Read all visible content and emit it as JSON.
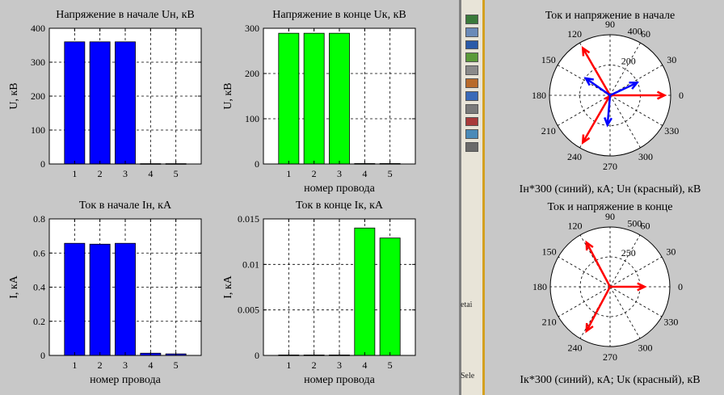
{
  "colors": {
    "background": "#c8c8c8",
    "blue": "#0000ff",
    "green": "#00ff00",
    "red": "#ff0000",
    "axes": "#ffffff"
  },
  "strip": {
    "labels": [
      "etai",
      "Sele"
    ]
  },
  "chart_data": [
    {
      "id": "un",
      "type": "bar",
      "title": "Напряжение в начале Uн, кВ",
      "xlabel": "",
      "ylabel": "U, кВ",
      "categories": [
        "1",
        "2",
        "3",
        "4",
        "5"
      ],
      "values": [
        360,
        360,
        360,
        1,
        1
      ],
      "ylim": [
        0,
        400
      ],
      "yticks": [
        "0",
        "100",
        "200",
        "300",
        "400"
      ],
      "grid": true,
      "color": "#0000ff"
    },
    {
      "id": "uk",
      "type": "bar",
      "title": "Напряжение в конце Uк, кВ",
      "xlabel": "номер провода",
      "ylabel": "U, кВ",
      "categories": [
        "1",
        "2",
        "3",
        "4",
        "5"
      ],
      "values": [
        289,
        289,
        289,
        1,
        1
      ],
      "ylim": [
        0,
        300
      ],
      "yticks": [
        "0",
        "100",
        "200",
        "300"
      ],
      "grid": true,
      "color": "#00ff00"
    },
    {
      "id": "in",
      "type": "bar",
      "title": "Ток в начале Iн, кА",
      "xlabel": "номер провода",
      "ylabel": "I, кА",
      "categories": [
        "1",
        "2",
        "3",
        "4",
        "5"
      ],
      "values": [
        0.657,
        0.652,
        0.657,
        0.013,
        0.009
      ],
      "ylim": [
        0,
        0.8
      ],
      "yticks": [
        "0",
        "0.2",
        "0.4",
        "0.6",
        "0.8"
      ],
      "grid": true,
      "color": "#0000ff"
    },
    {
      "id": "ik",
      "type": "bar",
      "title": "Ток в конце Iк, кА",
      "xlabel": "номер провода",
      "ylabel": "I, кА",
      "categories": [
        "1",
        "2",
        "3",
        "4",
        "5"
      ],
      "values": [
        5e-05,
        5e-05,
        5e-05,
        0.014,
        0.0129
      ],
      "ylim": [
        0,
        0.015
      ],
      "yticks": [
        "0",
        "0.005",
        "0.01",
        "0.015"
      ],
      "grid": true,
      "color": "#00ff00"
    },
    {
      "id": "polar_start",
      "type": "polar",
      "title": "Ток и напряжение в начале",
      "xlabel": "Iн*300 (синий), кА; Uн (красный), кВ",
      "rmax": 400,
      "rticks": [
        "200",
        "400"
      ],
      "angle_ticks": [
        "0",
        "30",
        "60",
        "90",
        "120",
        "150",
        "180",
        "210",
        "240",
        "270",
        "300",
        "330"
      ],
      "series": [
        {
          "color": "#ff0000",
          "vectors": [
            {
              "r": 360,
              "angle": 0
            },
            {
              "r": 360,
              "angle": 120
            },
            {
              "r": 360,
              "angle": 240
            },
            {
              "r": 12,
              "angle": 0
            },
            {
              "r": 12,
              "angle": 0
            }
          ]
        },
        {
          "color": "#0000ff",
          "vectors": [
            {
              "r": 197,
              "angle": 25
            },
            {
              "r": 196,
              "angle": 145
            },
            {
              "r": 197,
              "angle": 265
            },
            {
              "r": 4,
              "angle": 0
            },
            {
              "r": 3,
              "angle": 0
            }
          ]
        }
      ]
    },
    {
      "id": "polar_end",
      "type": "polar",
      "title": "Ток и напряжение в конце",
      "xlabel": "Iк*300 (синий), кА; Uк (красный), кВ",
      "rmax": 500,
      "rticks": [
        "250",
        "500"
      ],
      "angle_ticks": [
        "0",
        "30",
        "60",
        "90",
        "120",
        "150",
        "180",
        "210",
        "240",
        "270",
        "300",
        "330"
      ],
      "series": [
        {
          "color": "#ff0000",
          "vectors": [
            {
              "r": 289,
              "angle": 0
            },
            {
              "r": 420,
              "angle": 118
            },
            {
              "r": 420,
              "angle": 242
            },
            {
              "r": 10,
              "angle": 0
            },
            {
              "r": 10,
              "angle": 0
            }
          ]
        },
        {
          "color": "#0000ff",
          "vectors": [
            {
              "r": 4,
              "angle": 0
            },
            {
              "r": 4,
              "angle": 45
            },
            {
              "r": 4,
              "angle": 90
            }
          ]
        }
      ]
    }
  ]
}
